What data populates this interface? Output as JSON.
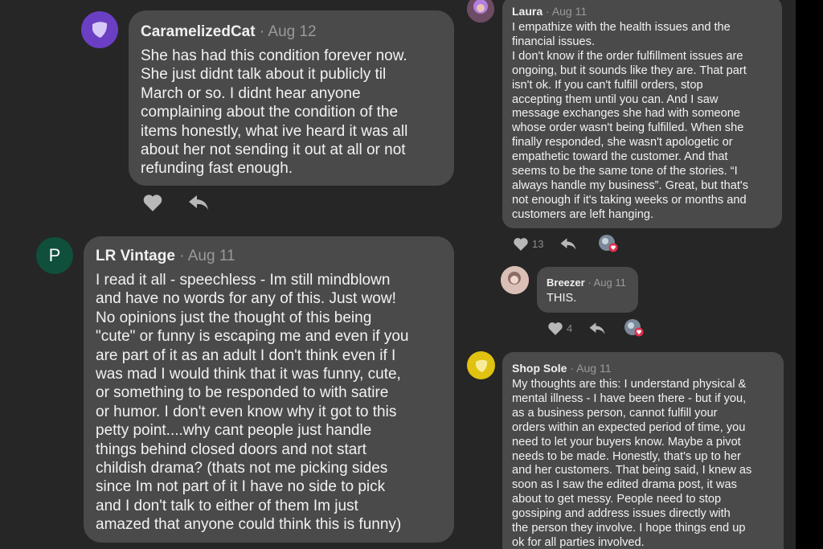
{
  "comments": {
    "caramelized": {
      "name": "CaramelizedCat",
      "date": "Aug 12",
      "text": "She has had this condition forever now.\nShe just didnt talk about it publicly til\nMarch or so. I didnt hear anyone\ncomplaining about the condition of the\nitems honestly,  what ive heard it was all\nabout her not sending it out at all or not\nrefunding fast enough."
    },
    "lr_vintage": {
      "avatar_letter": "P",
      "name": "LR Vintage",
      "date": "Aug 11",
      "text": "I read it all - speechless - Im still mindblown\nand have no words for any of this.  Just wow!\nNo opinions just the thought of this being\n\"cute\" or funny is escaping me and even if you\nare part of it as an adult I don't think even if I\nwas mad I would think that it was funny, cute,\nor something to be responded to with satire\nor humor.  I don't even know why it got to this\npetty point....why cant people just handle\nthings behind closed doors and not start\nchildish drama? (thats not me picking sides\nsince Im not part of it I have no side to pick\nand I don't talk to either of them Im just\namazed that anyone could think this is funny)"
    },
    "laura": {
      "name": "Laura",
      "date": "Aug 11",
      "text": "I empathize with the health issues and the\nfinancial issues.\nI don't know if the order fulfillment issues are\nongoing, but it sounds like they are. That part\nisn't ok. If you can't fulfill orders, stop\naccepting them until you can. And I saw\nmessage exchanges she had with someone\nwhose order wasn't being fulfilled. When she\nfinally responded, she wasn't apologetic or\nempathetic toward the customer. And that\nseems to be the same tone of the stories. “I\nalways handle my business”. Great, but that's\nnot enough if it's taking weeks or months and\ncustomers are left hanging.",
      "likes": "13"
    },
    "breezer": {
      "name": "Breezer",
      "date": "Aug 11",
      "text": "THIS.",
      "likes": "4"
    },
    "shop_sole": {
      "name": "Shop Sole",
      "date": "Aug 11",
      "text": "My thoughts are this:  I understand physical &\nmental illness - I have been there - but if you,\nas a business person, cannot fulfill your\norders within an expected period of time, you\nneed to let your buyers know.  Maybe a pivot\nneeds to be made.  Honestly, that's up to her\nand her customers.  That being said, I knew as\nsoon as I saw the edited drama post, it was\nabout to get messy.  People need to stop\ngossiping and address issues directly with\nthe person they involve.  I hope things end up\nok for all parties involved."
    }
  },
  "separator": "·",
  "icons": {
    "like": "heart-icon",
    "reply": "reply-arrow-icon",
    "reactions": "reaction-avatars-icon"
  },
  "colors": {
    "background": "#262626",
    "bubble": "#4a4a4a",
    "lr_vintage_avatar": "#0f4f3b",
    "caramelized_avatar": "#6a3fc4",
    "shop_sole_avatar": "#e0c210",
    "like_icon": "#b8b8b8",
    "reaction_badge": "#e03050"
  }
}
